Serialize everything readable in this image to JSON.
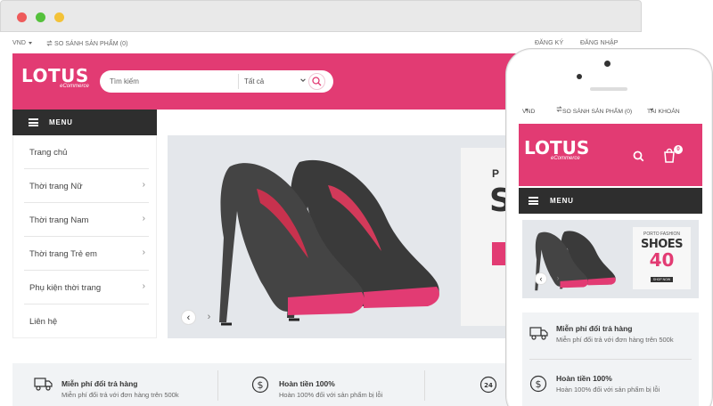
{
  "browser": {
    "controls": [
      "close",
      "maximize",
      "minimize"
    ]
  },
  "topbar": {
    "currency": "VND",
    "compare": "SO SÁNH SẢN PHẨM (0)",
    "register": "ĐĂNG KÝ",
    "login": "ĐĂNG NHẬP"
  },
  "header": {
    "logo_main": "LOTUS",
    "logo_sub": "eCommerce",
    "search_placeholder": "Tìm kiếm",
    "category_selected": "Tất cả"
  },
  "menu": {
    "label": "MENU",
    "items": [
      {
        "label": "Trang chủ",
        "has_children": false
      },
      {
        "label": "Thời trang Nữ",
        "has_children": true
      },
      {
        "label": "Thời trang Nam",
        "has_children": true
      },
      {
        "label": "Thời trang Trẻ em",
        "has_children": true
      },
      {
        "label": "Phụ kiện thời trang",
        "has_children": true
      },
      {
        "label": "Liên hệ",
        "has_children": false
      }
    ]
  },
  "banner": {
    "promo_text": "P",
    "promo_big": "S"
  },
  "features": [
    {
      "icon": "truck-icon",
      "title": "Miễn phí đổi trả hàng",
      "desc": "Miễn phí đổi trả với đơn hàng trên 500k"
    },
    {
      "icon": "dollar-icon",
      "title": "Hoàn tiền 100%",
      "desc": "Hoàn 100% đối với sản phẩm bị lỗi"
    },
    {
      "icon": "support-24-icon",
      "title": "",
      "desc": ""
    }
  ],
  "mobile": {
    "currency": "VND",
    "compare": "SO SÁNH SẢN PHẨM (0)",
    "account": "TÀI KHOẢN",
    "logo_main": "LOTUS",
    "logo_sub": "eCommerce",
    "cart_count": "0",
    "menu_label": "MENU",
    "promo_brand": "PORTO FASHION",
    "promo_title": "SHOES",
    "promo_discount": "40",
    "promo_button": "SHOP NOW",
    "features": [
      {
        "icon": "truck-icon",
        "title": "Miễn phí đổi trả hàng",
        "desc": "Miễn phí đổi trả với đơn hàng trên 500k"
      },
      {
        "icon": "dollar-icon",
        "title": "Hoàn tiền 100%",
        "desc": "Hoàn 100% đối với sản phẩm bị lỗi"
      }
    ]
  },
  "colors": {
    "brand_pink": "#e23b73",
    "menu_dark": "#2e2e2e",
    "feature_bg": "#f1f3f5"
  }
}
